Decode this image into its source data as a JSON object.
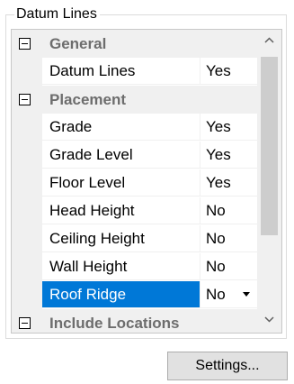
{
  "group": {
    "title": "Datum Lines"
  },
  "grid": {
    "rows": [
      {
        "kind": "category",
        "label": "General"
      },
      {
        "kind": "prop",
        "name": "Datum Lines",
        "value": "Yes"
      },
      {
        "kind": "category",
        "label": "Placement"
      },
      {
        "kind": "prop",
        "name": "Grade",
        "value": "Yes"
      },
      {
        "kind": "prop",
        "name": "Grade Level",
        "value": "Yes"
      },
      {
        "kind": "prop",
        "name": "Floor Level",
        "value": "Yes"
      },
      {
        "kind": "prop",
        "name": "Head Height",
        "value": "No"
      },
      {
        "kind": "prop",
        "name": "Ceiling Height",
        "value": "No"
      },
      {
        "kind": "prop",
        "name": "Wall Height",
        "value": "No"
      },
      {
        "kind": "prop",
        "name": "Roof Ridge",
        "value": "No",
        "selected": true,
        "dropdown": true
      },
      {
        "kind": "category",
        "label": "Include Locations"
      }
    ]
  },
  "icons": {
    "expander": "collapse-minus-icon",
    "scroll_up": "chevron-up-icon",
    "scroll_down": "chevron-down-icon",
    "dropdown": "dropdown-arrow-icon"
  },
  "colors": {
    "selection": "#0078d7",
    "category_text": "#6d6d6d",
    "category_background": "#f0f0f0"
  },
  "buttons": {
    "settings_label": "Settings..."
  }
}
